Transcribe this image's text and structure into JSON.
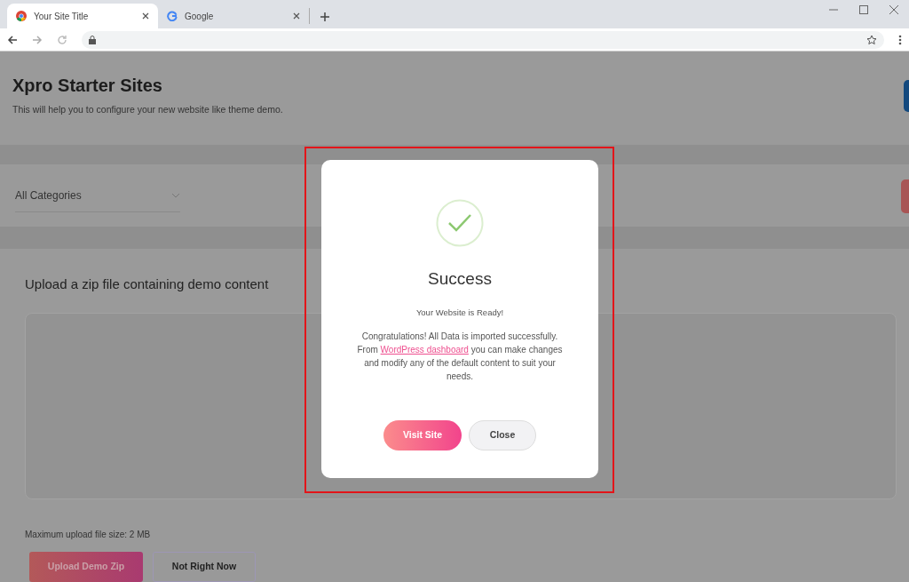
{
  "browser": {
    "tabs": [
      {
        "title": "Your Site Title",
        "selected": true,
        "kind": "chrome"
      },
      {
        "title": "Google",
        "selected": false,
        "kind": "google"
      }
    ]
  },
  "page": {
    "title": "Xpro Starter Sites",
    "subtitle": "This will help you to configure your new website like theme demo.",
    "category_select": {
      "value": "All Categories"
    },
    "upload": {
      "heading": "Upload a zip file containing demo content",
      "note": "Maximum upload file size: 2 MB",
      "buttons": [
        {
          "label": "Upload Demo Zip",
          "kind": "primary"
        },
        {
          "label": "Not Right Now",
          "kind": "secondary"
        }
      ]
    }
  },
  "modal": {
    "title": "Success",
    "subtitle": "Your Website is Ready!",
    "message": {
      "before": "Congratulations! All Data is imported successfully. From",
      "link": "WordPress dashboard",
      "after": "you can make changes and modify any of the default content to suit your needs."
    },
    "buttons": [
      {
        "label": "Visit Site",
        "kind": "primary"
      },
      {
        "label": "Close",
        "kind": "secondary"
      }
    ]
  }
}
